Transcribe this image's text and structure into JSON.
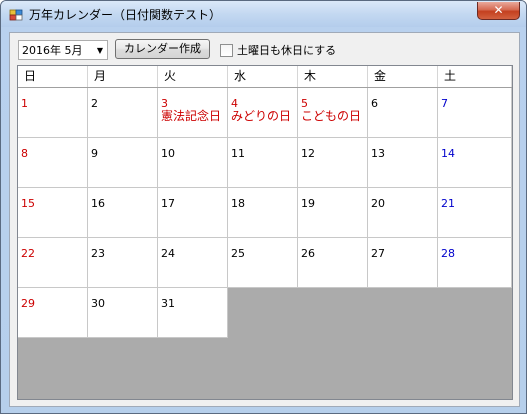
{
  "window": {
    "title": "万年カレンダー（日付関数テスト）",
    "close_symbol": "✕"
  },
  "toolbar": {
    "month_select_value": "2016年  5月",
    "create_button_label": "カレンダー作成",
    "saturday_holiday_label": "土曜日も休日にする",
    "saturday_holiday_checked": false
  },
  "calendar": {
    "weekdays": [
      "日",
      "月",
      "火",
      "水",
      "木",
      "金",
      "土"
    ],
    "weeks": [
      [
        {
          "day": "1",
          "color": "red",
          "holiday": ""
        },
        {
          "day": "2",
          "color": "black",
          "holiday": ""
        },
        {
          "day": "3",
          "color": "red",
          "holiday": "憲法記念日"
        },
        {
          "day": "4",
          "color": "red",
          "holiday": "みどりの日"
        },
        {
          "day": "5",
          "color": "red",
          "holiday": "こどもの日"
        },
        {
          "day": "6",
          "color": "black",
          "holiday": ""
        },
        {
          "day": "7",
          "color": "blue",
          "holiday": ""
        }
      ],
      [
        {
          "day": "8",
          "color": "red",
          "holiday": ""
        },
        {
          "day": "9",
          "color": "black",
          "holiday": ""
        },
        {
          "day": "10",
          "color": "black",
          "holiday": ""
        },
        {
          "day": "11",
          "color": "black",
          "holiday": ""
        },
        {
          "day": "12",
          "color": "black",
          "holiday": ""
        },
        {
          "day": "13",
          "color": "black",
          "holiday": ""
        },
        {
          "day": "14",
          "color": "blue",
          "holiday": ""
        }
      ],
      [
        {
          "day": "15",
          "color": "red",
          "holiday": ""
        },
        {
          "day": "16",
          "color": "black",
          "holiday": ""
        },
        {
          "day": "17",
          "color": "black",
          "holiday": ""
        },
        {
          "day": "18",
          "color": "black",
          "holiday": ""
        },
        {
          "day": "19",
          "color": "black",
          "holiday": ""
        },
        {
          "day": "20",
          "color": "black",
          "holiday": ""
        },
        {
          "day": "21",
          "color": "blue",
          "holiday": ""
        }
      ],
      [
        {
          "day": "22",
          "color": "red",
          "holiday": ""
        },
        {
          "day": "23",
          "color": "black",
          "holiday": ""
        },
        {
          "day": "24",
          "color": "black",
          "holiday": ""
        },
        {
          "day": "25",
          "color": "black",
          "holiday": ""
        },
        {
          "day": "26",
          "color": "black",
          "holiday": ""
        },
        {
          "day": "27",
          "color": "black",
          "holiday": ""
        },
        {
          "day": "28",
          "color": "blue",
          "holiday": ""
        }
      ],
      [
        {
          "day": "29",
          "color": "red",
          "holiday": ""
        },
        {
          "day": "30",
          "color": "black",
          "holiday": ""
        },
        {
          "day": "31",
          "color": "black",
          "holiday": ""
        }
      ]
    ]
  },
  "icons": {
    "app": "calendar-app-icon",
    "dropdown": "chevron-down-icon",
    "close": "close-icon"
  },
  "colors": {
    "sunday_holiday": "#cc0000",
    "saturday": "#0000cc",
    "grid_background": "#ababab"
  }
}
